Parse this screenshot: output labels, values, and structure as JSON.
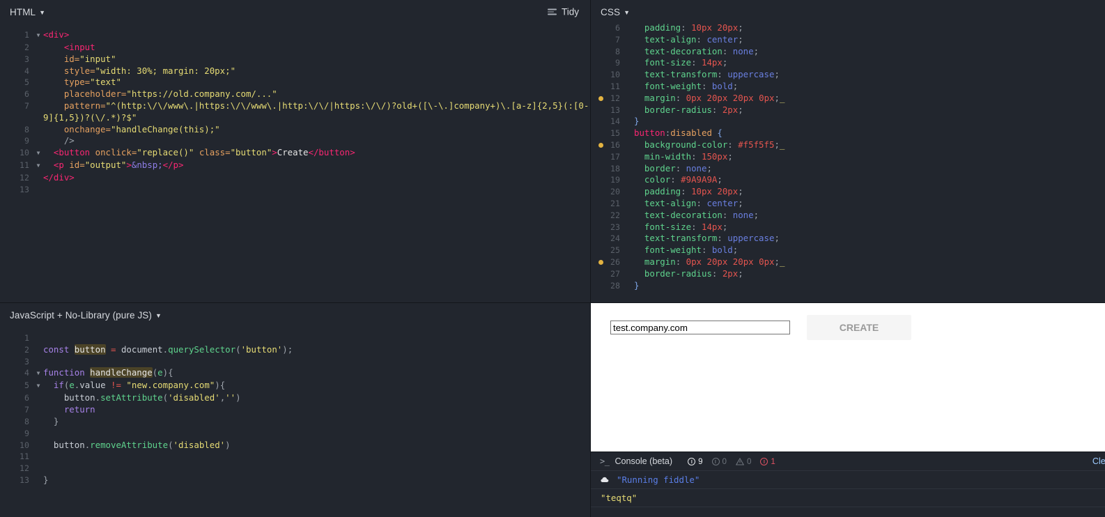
{
  "panels": {
    "html": {
      "title": "HTML",
      "tidy_label": "Tidy",
      "lines": [
        {
          "n": "1",
          "fold": true,
          "html": "<span class=\"t-tag\">&lt;div&gt;</span>"
        },
        {
          "n": "2",
          "fold": false,
          "html": "    <span class=\"t-tag\">&lt;input</span>"
        },
        {
          "n": "3",
          "fold": false,
          "html": "    <span class=\"t-attr\">id=</span><span class=\"t-str\">\"input\"</span>"
        },
        {
          "n": "4",
          "fold": false,
          "html": "    <span class=\"t-attr\">style=</span><span class=\"t-str\">\"width: 30%; margin: 20px;\"</span>"
        },
        {
          "n": "5",
          "fold": false,
          "html": "    <span class=\"t-attr\">type=</span><span class=\"t-str\">\"text\"</span>"
        },
        {
          "n": "6",
          "fold": false,
          "html": "    <span class=\"t-attr\">placeholder=</span><span class=\"t-str\">\"https://old.company.com/...\"</span>"
        },
        {
          "n": "7",
          "fold": false,
          "html": "    <span class=\"t-attr\">pattern=</span><span class=\"t-str\">\"^(http:\\/\\/www\\.|https:\\/\\/www\\.|http:\\/\\/|https:\\/\\/)?old+([\\-\\.]company+)\\.[a-z]{2,5}(:[0-9]{1,5})?(\\/.*)?$\"</span>"
        },
        {
          "n": "8",
          "fold": false,
          "html": "    <span class=\"t-attr\">onchange=</span><span class=\"t-str\">\"handleChange(this);\"</span>"
        },
        {
          "n": "9",
          "fold": false,
          "html": "    <span class=\"t-punct\">/&gt;</span>"
        },
        {
          "n": "10",
          "fold": true,
          "html": "  <span class=\"t-tag\">&lt;button</span> <span class=\"t-attr\">onclick=</span><span class=\"t-str\">\"replace()\"</span> <span class=\"t-attr\">class=</span><span class=\"t-str\">\"button\"</span><span class=\"t-tag\">&gt;</span><span class=\"t-plain\">Create</span><span class=\"t-tag\">&lt;/button&gt;</span>"
        },
        {
          "n": "11",
          "fold": true,
          "html": "  <span class=\"t-tag\">&lt;p</span> <span class=\"t-attr\">id=</span><span class=\"t-str\">\"output\"</span><span class=\"t-tag\">&gt;</span><span class=\"t-ent\">&amp;nbsp;</span><span class=\"t-tag\">&lt;/p&gt;</span>"
        },
        {
          "n": "12",
          "fold": false,
          "html": "<span class=\"t-tag\">&lt;/div&gt;</span>"
        },
        {
          "n": "13",
          "fold": false,
          "html": ""
        }
      ]
    },
    "css": {
      "title": "CSS",
      "lines": [
        {
          "n": "6",
          "clipped": true,
          "dot": false,
          "html": "  <span class=\"t-prop\">padding</span><span class=\"t-punct\">:</span> <span class=\"t-num\">10px</span> <span class=\"t-num\">20px</span><span class=\"t-punct\">;</span>"
        },
        {
          "n": "7",
          "dot": false,
          "html": "  <span class=\"t-prop\">text-align</span><span class=\"t-punct\">:</span> <span class=\"t-val\">center</span><span class=\"t-punct\">;</span>"
        },
        {
          "n": "8",
          "dot": false,
          "html": "  <span class=\"t-prop\">text-decoration</span><span class=\"t-punct\">:</span> <span class=\"t-val\">none</span><span class=\"t-punct\">;</span>"
        },
        {
          "n": "9",
          "dot": false,
          "html": "  <span class=\"t-prop\">font-size</span><span class=\"t-punct\">:</span> <span class=\"t-num\">14px</span><span class=\"t-punct\">;</span>"
        },
        {
          "n": "10",
          "dot": false,
          "html": "  <span class=\"t-prop\">text-transform</span><span class=\"t-punct\">:</span> <span class=\"t-val\">uppercase</span><span class=\"t-punct\">;</span>"
        },
        {
          "n": "11",
          "dot": false,
          "html": "  <span class=\"t-prop\">font-weight</span><span class=\"t-punct\">:</span> <span class=\"t-val\">bold</span><span class=\"t-punct\">;</span>"
        },
        {
          "n": "12",
          "dot": true,
          "html": "  <span class=\"t-prop\">margin</span><span class=\"t-punct\">:</span> <span class=\"t-num\">0px</span> <span class=\"t-num\">20px</span> <span class=\"t-num\">20px</span> <span class=\"t-num\">0px</span><span class=\"t-punct\">;</span><span class=\"cursor-u\">_</span>"
        },
        {
          "n": "13",
          "dot": false,
          "html": "  <span class=\"t-prop\">border-radius</span><span class=\"t-punct\">:</span> <span class=\"t-num\">2px</span><span class=\"t-punct\">;</span>"
        },
        {
          "n": "14",
          "dot": false,
          "html": "<span class=\"t-brace\">}</span>"
        },
        {
          "n": "15",
          "dot": false,
          "html": "<span class=\"t-sel\">button</span><span class=\"t-punct\">:</span><span class=\"t-pseudo\">disabled</span> <span class=\"t-brace\">{</span>"
        },
        {
          "n": "16",
          "dot": true,
          "html": "  <span class=\"t-prop\">background-color</span><span class=\"t-punct\">:</span> <span class=\"t-num\">#f5f5f5</span><span class=\"t-punct\">;</span><span class=\"cursor-u\">_</span>"
        },
        {
          "n": "17",
          "dot": false,
          "html": "  <span class=\"t-prop\">min-width</span><span class=\"t-punct\">:</span> <span class=\"t-num\">150px</span><span class=\"t-punct\">;</span>"
        },
        {
          "n": "18",
          "dot": false,
          "html": "  <span class=\"t-prop\">border</span><span class=\"t-punct\">:</span> <span class=\"t-val\">none</span><span class=\"t-punct\">;</span>"
        },
        {
          "n": "19",
          "dot": false,
          "html": "  <span class=\"t-prop\">color</span><span class=\"t-punct\">:</span> <span class=\"t-num\">#9A9A9A</span><span class=\"t-punct\">;</span>"
        },
        {
          "n": "20",
          "dot": false,
          "html": "  <span class=\"t-prop\">padding</span><span class=\"t-punct\">:</span> <span class=\"t-num\">10px</span> <span class=\"t-num\">20px</span><span class=\"t-punct\">;</span>"
        },
        {
          "n": "21",
          "dot": false,
          "html": "  <span class=\"t-prop\">text-align</span><span class=\"t-punct\">:</span> <span class=\"t-val\">center</span><span class=\"t-punct\">;</span>"
        },
        {
          "n": "22",
          "dot": false,
          "html": "  <span class=\"t-prop\">text-decoration</span><span class=\"t-punct\">:</span> <span class=\"t-val\">none</span><span class=\"t-punct\">;</span>"
        },
        {
          "n": "23",
          "dot": false,
          "html": "  <span class=\"t-prop\">font-size</span><span class=\"t-punct\">:</span> <span class=\"t-num\">14px</span><span class=\"t-punct\">;</span>"
        },
        {
          "n": "24",
          "dot": false,
          "html": "  <span class=\"t-prop\">text-transform</span><span class=\"t-punct\">:</span> <span class=\"t-val\">uppercase</span><span class=\"t-punct\">;</span>"
        },
        {
          "n": "25",
          "dot": false,
          "html": "  <span class=\"t-prop\">font-weight</span><span class=\"t-punct\">:</span> <span class=\"t-val\">bold</span><span class=\"t-punct\">;</span>"
        },
        {
          "n": "26",
          "dot": true,
          "html": "  <span class=\"t-prop\">margin</span><span class=\"t-punct\">:</span> <span class=\"t-num\">0px</span> <span class=\"t-num\">20px</span> <span class=\"t-num\">20px</span> <span class=\"t-num\">0px</span><span class=\"t-punct\">;</span><span class=\"cursor-u\">_</span>"
        },
        {
          "n": "27",
          "dot": false,
          "html": "  <span class=\"t-prop\">border-radius</span><span class=\"t-punct\">:</span> <span class=\"t-num\">2px</span><span class=\"t-punct\">;</span>"
        },
        {
          "n": "28",
          "dot": false,
          "html": "<span class=\"t-brace\">}</span>"
        }
      ]
    },
    "js": {
      "title": "JavaScript + No-Library (pure JS)",
      "lines": [
        {
          "n": "1",
          "fold": false,
          "html": ""
        },
        {
          "n": "2",
          "fold": false,
          "html": "<span class=\"t-kw\">const</span> <span class=\"t-hl\">button</span> <span class=\"t-op\">=</span> <span class=\"t-id\">document</span><span class=\"t-punct\">.</span><span class=\"t-fn\">querySelector</span><span class=\"t-punct\">(</span><span class=\"t-str\">'button'</span><span class=\"t-punct\">);</span>"
        },
        {
          "n": "3",
          "fold": false,
          "html": ""
        },
        {
          "n": "4",
          "fold": true,
          "html": "<span class=\"t-kw\">function</span> <span class=\"t-hl\">handleChange</span><span class=\"t-punct\">(</span><span class=\"t-var\">e</span><span class=\"t-punct\">){</span>"
        },
        {
          "n": "5",
          "fold": true,
          "html": "  <span class=\"t-kw\">if</span><span class=\"t-punct\">(</span><span class=\"t-var\">e</span><span class=\"t-punct\">.</span><span class=\"t-id\">value</span> <span class=\"t-op\">!=</span> <span class=\"t-str\">\"new.company.com\"</span><span class=\"t-punct\">){</span>"
        },
        {
          "n": "6",
          "fold": false,
          "html": "    <span class=\"t-id\">button</span><span class=\"t-punct\">.</span><span class=\"t-fn\">setAttribute</span><span class=\"t-punct\">(</span><span class=\"t-str\">'disabled'</span><span class=\"t-punct\">,</span><span class=\"t-str\">''</span><span class=\"t-punct\">)</span>"
        },
        {
          "n": "7",
          "fold": false,
          "html": "    <span class=\"t-kw\">return</span>"
        },
        {
          "n": "8",
          "fold": false,
          "html": "  <span class=\"t-punct\">}</span>"
        },
        {
          "n": "9",
          "fold": false,
          "html": ""
        },
        {
          "n": "10",
          "fold": false,
          "html": "  <span class=\"t-id\">button</span><span class=\"t-punct\">.</span><span class=\"t-fn\">removeAttribute</span><span class=\"t-punct\">(</span><span class=\"t-str\">'disabled'</span><span class=\"t-punct\">)</span>"
        },
        {
          "n": "11",
          "fold": false,
          "html": ""
        },
        {
          "n": "12",
          "fold": false,
          "html": ""
        },
        {
          "n": "13",
          "fold": false,
          "html": "<span class=\"t-punct\">}</span>"
        }
      ]
    },
    "result": {
      "input_value": "test.company.com",
      "input_placeholder": "https://old.company.com/...",
      "button_label": "Create"
    }
  },
  "console": {
    "title": "Console (beta)",
    "prompt": ">_",
    "clear_label": "Clear",
    "counters": [
      {
        "name": "log-count",
        "value": "9",
        "tone": "cn-info"
      },
      {
        "name": "info-count",
        "value": "0",
        "tone": "cn-dim"
      },
      {
        "name": "warning-count",
        "value": "0",
        "tone": "cn-warn"
      },
      {
        "name": "error-count",
        "value": "1",
        "tone": "cn-err"
      }
    ],
    "messages": [
      {
        "text": "\"Running fiddle\"",
        "tone": "msg-blue",
        "icon": "cloud-icon"
      },
      {
        "text": "\"teqtq\"",
        "tone": "msg-yellow",
        "icon": "none"
      }
    ]
  },
  "colors": {
    "editor_bg": "#22262e",
    "panel_divider": "#13161b",
    "accent_yellow": "#e3b341",
    "error_red": "#e05263",
    "disabled_btn_bg": "#f5f5f5",
    "disabled_btn_text": "#9A9A9A"
  }
}
